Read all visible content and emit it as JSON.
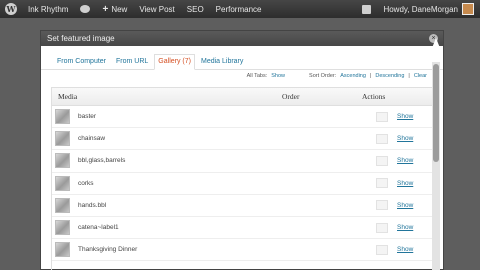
{
  "adminbar": {
    "site_name": "Ink Rhythm",
    "new_label": "New",
    "view_post": "View Post",
    "seo": "SEO",
    "performance": "Performance",
    "howdy": "Howdy, DaneMorgan"
  },
  "modal": {
    "title": "Set featured image",
    "tabs": [
      "From Computer",
      "From URL",
      "Gallery (7)",
      "Media Library"
    ],
    "active_tab": "Gallery (7)",
    "filters": {
      "all_tabs_label": "All Tabs:",
      "all_tabs_value": "Show",
      "sort_label": "Sort Order:",
      "ascending": "Ascending",
      "sep1": "|",
      "descending": "Descending",
      "sep2": "|",
      "clear": "Clear"
    },
    "table": {
      "col_media": "Media",
      "col_order": "Order",
      "col_actions": "Actions",
      "show_label": "Show",
      "rows": [
        {
          "title": "baster"
        },
        {
          "title": "chainsaw"
        },
        {
          "title": "bbl,glass,barrels"
        },
        {
          "title": "corks"
        },
        {
          "title": "hands.bbl"
        },
        {
          "title": "catena~label1"
        },
        {
          "title": "Thanksgiving Dinner"
        }
      ]
    }
  },
  "colors": {
    "link": "#21759b",
    "active_tab": "#d54e21",
    "adminbar": "#2d2d2d"
  }
}
